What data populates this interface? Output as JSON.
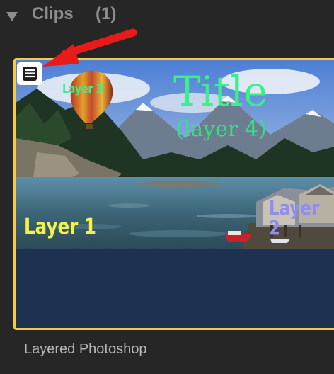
{
  "section": {
    "title": "Clips",
    "count": "(1)"
  },
  "clip": {
    "name": "Layered Photoshop",
    "badge_icon": "layers-icon",
    "selected_border_color": "#f2c94c"
  },
  "thumbnail": {
    "title_text": "Title",
    "subtitle_text": "(layer 4)",
    "layer1_text": "Layer 1",
    "layer2_text": "Layer 2",
    "layer3_text": "Layer 3"
  },
  "annotation": {
    "arrow_icon": "red-arrow-icon",
    "arrow_color": "#e81b1b"
  }
}
